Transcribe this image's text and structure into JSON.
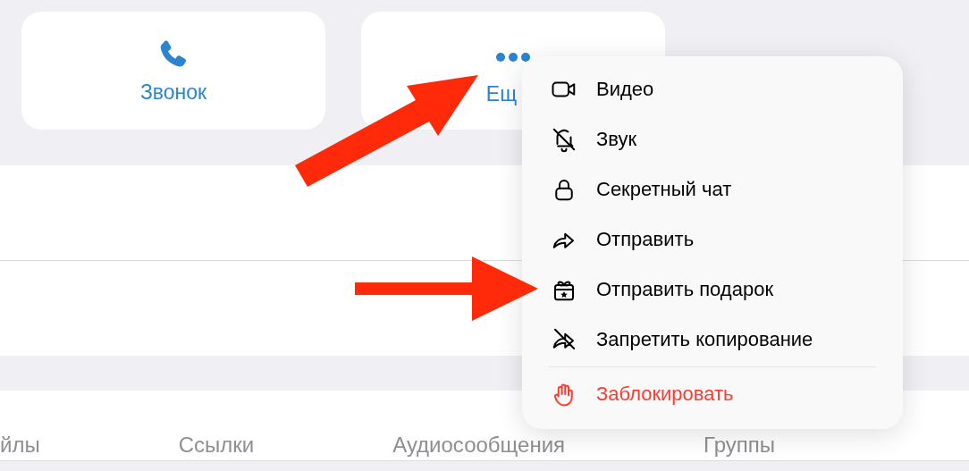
{
  "actions": [
    {
      "label": "Звонок",
      "kind": "call"
    },
    {
      "label": "Ещ",
      "kind": "more"
    }
  ],
  "tabs": [
    "йлы",
    "Ссылки",
    "Аудиосообщения",
    "Группы"
  ],
  "menu": {
    "items": [
      {
        "label": "Видео",
        "destructive": false
      },
      {
        "label": "Звук",
        "destructive": false
      },
      {
        "label": "Секретный чат",
        "destructive": false
      },
      {
        "label": "Отправить",
        "destructive": false
      },
      {
        "label": "Отправить подарок",
        "destructive": false
      },
      {
        "label": "Запретить копирование",
        "destructive": false
      },
      {
        "label": "Заблокировать",
        "destructive": true
      }
    ]
  }
}
